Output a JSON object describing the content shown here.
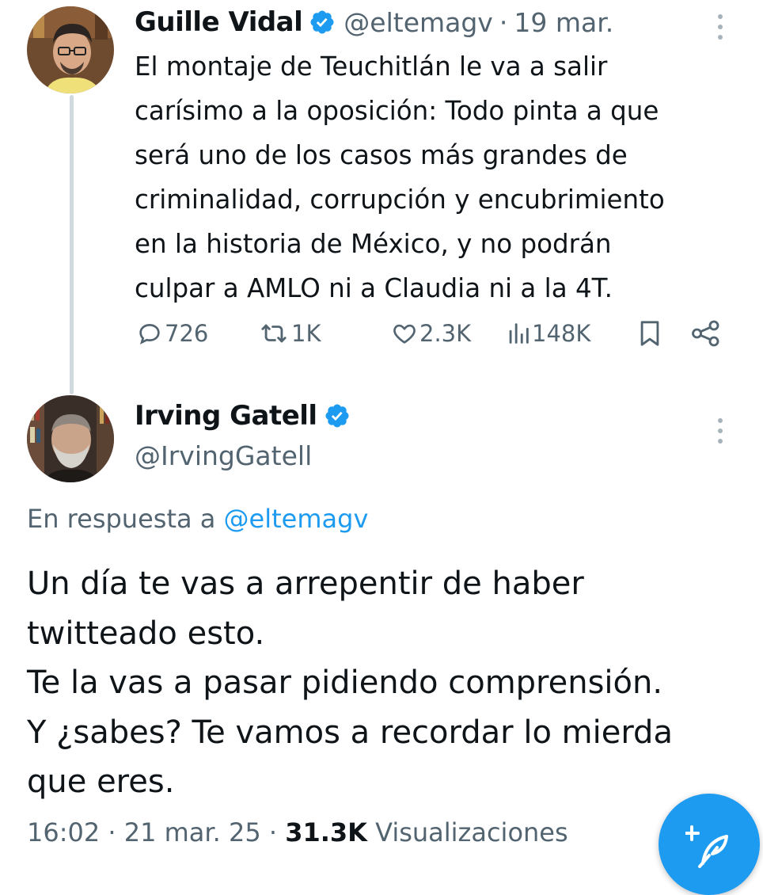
{
  "tweet1": {
    "author_name": "Guille Vidal",
    "handle": "@eltemagv",
    "separator": "·",
    "date": "19 mar.",
    "body_lines": [
      "El montaje de Teuchitlán le va a salir",
      "carísimo a la oposición: Todo pinta a que",
      "será uno de los casos más  grandes de",
      "criminalidad, corrupción y encubrimiento",
      "en la historia de México, y no podrán",
      "culpar a AMLO ni a Claudia ni a la 4T."
    ],
    "replies": "726",
    "retweets": "1K",
    "likes": "2.3K",
    "views": "148K"
  },
  "tweet2": {
    "author_name": "Irving Gatell",
    "handle": "@IrvingGatell",
    "reply_prefix": "En respuesta a",
    "reply_mention": "@eltemagv",
    "body_lines": [
      "Un día te vas a arrepentir de haber",
      "twitteado esto.",
      "Te la vas a pasar pidiendo comprensión.",
      "Y ¿sabes? Te vamos a recordar lo mierda",
      "que eres."
    ],
    "time": "16:02",
    "separator": "·",
    "date": "21 mar. 25",
    "views_count": "31.3K",
    "views_label": "Visualizaciones"
  },
  "icons": {
    "verified": "verified-badge-icon",
    "reply": "reply-icon",
    "retweet": "retweet-icon",
    "like": "heart-icon",
    "views": "views-bar-icon",
    "bookmark": "bookmark-icon",
    "share": "share-icon",
    "more": "more-vertical-icon",
    "compose": "compose-feather-icon"
  },
  "colors": {
    "accent": "#1d9bf0",
    "text": "#0f1419",
    "secondary": "#536471"
  }
}
